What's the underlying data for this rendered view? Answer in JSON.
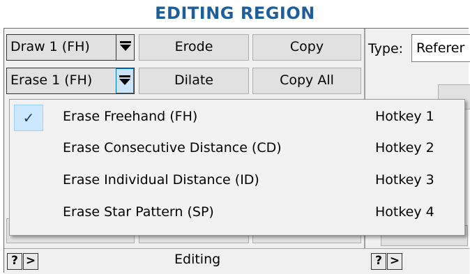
{
  "header": {
    "title": "EDITING REGION"
  },
  "editing": {
    "draw_combo": "Draw 1 (FH)",
    "erase_combo": "Erase 1 (FH)",
    "erode_label": "Erode",
    "dilate_label": "Dilate",
    "copy_label": "Copy",
    "copy_all_label": "Copy All"
  },
  "right_panel": {
    "type_label": "Type:",
    "type_value": "Referer"
  },
  "menu": {
    "items": [
      {
        "label": "Erase Freehand (FH)",
        "hotkey": "Hotkey 1",
        "checked": true
      },
      {
        "label": "Erase Consecutive Distance (CD)",
        "hotkey": "Hotkey 2",
        "checked": false
      },
      {
        "label": "Erase Individual Distance (ID)",
        "hotkey": "Hotkey 3",
        "checked": false
      },
      {
        "label": "Erase Star Pattern (SP)",
        "hotkey": "Hotkey 4",
        "checked": false
      }
    ],
    "check_glyph": "✓"
  },
  "status_bar": {
    "help_label": "?",
    "expand_label": ">",
    "section_label": "Editing"
  }
}
